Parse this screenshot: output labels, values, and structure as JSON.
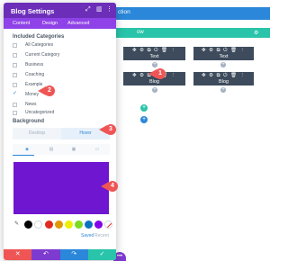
{
  "builder": {
    "section_label": "ction",
    "row_label": "ow",
    "modules": [
      {
        "tools": "✥ ⚙ ⧉ ⏻ 🗑 ⋮",
        "label": "Text"
      },
      {
        "tools": "✥ ⚙ ⧉ ⏻ 🗑 ⋮",
        "label": "Text"
      },
      {
        "tools": "✥ ⚙ ⧉ ⏻ 🗑 ⋮",
        "label": "Blog"
      },
      {
        "tools": "✥ ⚙ ⧉ ⏻ 🗑 ⋮",
        "label": "Blog"
      }
    ]
  },
  "panel": {
    "title": "Blog Settings",
    "header_icons": [
      "expand-icon",
      "columns-icon",
      "more-icon"
    ],
    "tabs": [
      "Content",
      "Design",
      "Advanced"
    ],
    "active_tab": "Content",
    "included_categories": {
      "title": "Included Categories",
      "items": [
        {
          "label": "All Categories",
          "checked": false
        },
        {
          "label": "Current Category",
          "checked": false
        },
        {
          "label": "Business",
          "checked": false
        },
        {
          "label": "Coaching",
          "checked": false
        },
        {
          "label": "Example",
          "checked": false
        },
        {
          "label": "Money",
          "checked": true
        },
        {
          "label": "News",
          "checked": false
        },
        {
          "label": "Uncategorized",
          "checked": false
        }
      ]
    },
    "background": {
      "title": "Background",
      "mode_desktop": "Desktop",
      "mode_hover": "Hover",
      "active_mode": "Hover",
      "fill_tabs": [
        "color-fill-icon",
        "gradient-icon",
        "image-icon",
        "video-icon"
      ],
      "selected_color": "#6f16d1",
      "palette": [
        "#000000",
        "#ffffff",
        "#e02b20",
        "#e09900",
        "#edf000",
        "#7cda24",
        "#0c71c3",
        "#8300e9"
      ],
      "saved_label": "Saved",
      "recent_label": "Recent"
    },
    "footer_buttons": [
      "close",
      "undo",
      "redo",
      "save"
    ]
  },
  "callouts": [
    "1",
    "2",
    "3",
    "4"
  ],
  "colors": {
    "accent_purple": "#6c2eb9",
    "accent_blue": "#2b87da",
    "accent_teal": "#29c4a9",
    "callout_red": "#ef5555"
  }
}
